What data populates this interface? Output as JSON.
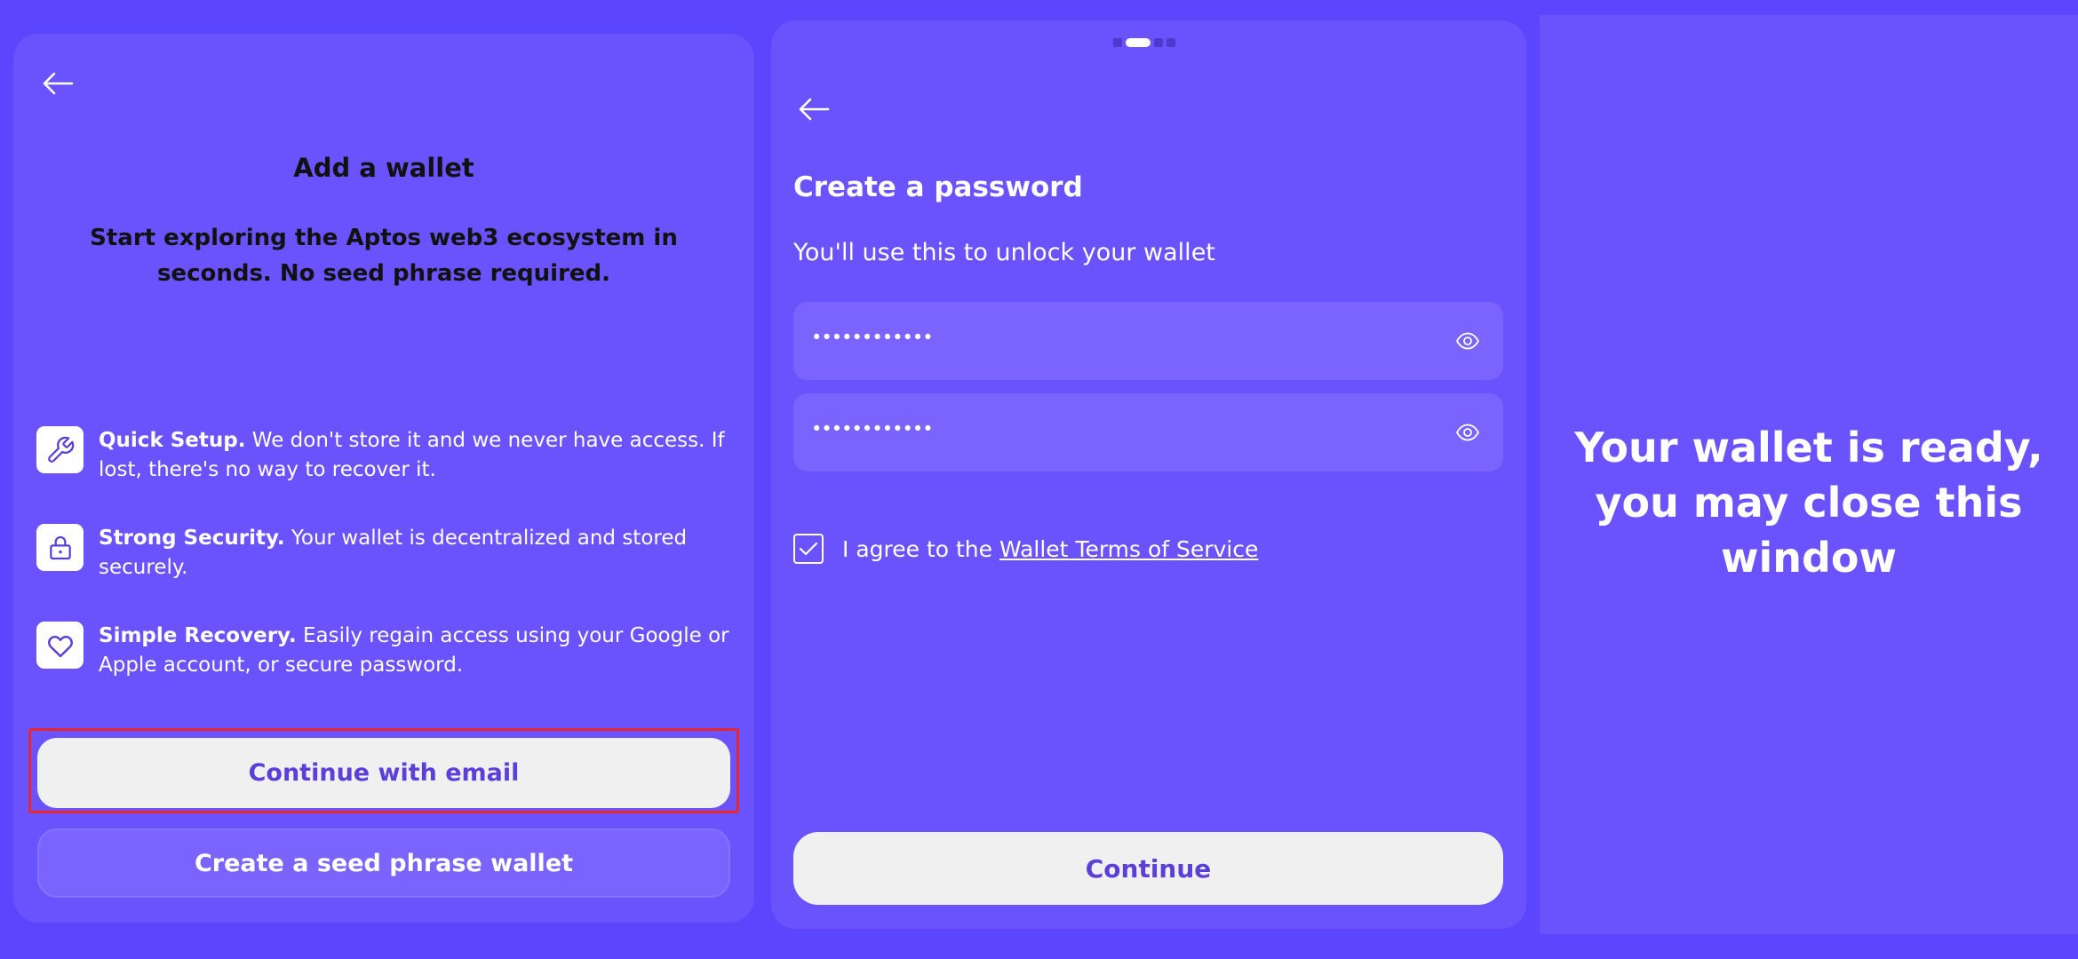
{
  "left_panel": {
    "title": "Add a wallet",
    "subtitle": "Start exploring the Aptos web3 ecosystem in seconds. No seed phrase required.",
    "features": [
      {
        "icon": "wrench-icon",
        "title": "Quick Setup.",
        "text": " We don't store it and we never have access. If lost, there's no way to recover it."
      },
      {
        "icon": "lock-icon",
        "title": "Strong Security.",
        "text": " Your wallet is decentralized and stored securely."
      },
      {
        "icon": "heart-icon",
        "title": "Simple Recovery.",
        "text": " Easily regain access using your Google or Apple account, or secure password."
      }
    ],
    "primary_button": "Continue with email",
    "secondary_button": "Create a seed phrase wallet"
  },
  "mid_panel": {
    "title": "Create a password",
    "subtitle": "You'll use this to unlock your wallet",
    "password_value": "••••••••••••",
    "confirm_password_value": "••••••••••••",
    "checkbox_checked": true,
    "agree_prefix": "I agree to the ",
    "terms_link": "Wallet Terms of Service",
    "continue_button": "Continue",
    "steps": 4,
    "active_step": 1
  },
  "right_panel": {
    "message": "Your wallet is ready, you may close this window"
  },
  "colors": {
    "background": "#5b45fd",
    "panel": "#6a52fd",
    "button_light": "#f1f0f1",
    "button_text": "#5a3fd8",
    "highlight_border": "#e8262e"
  }
}
